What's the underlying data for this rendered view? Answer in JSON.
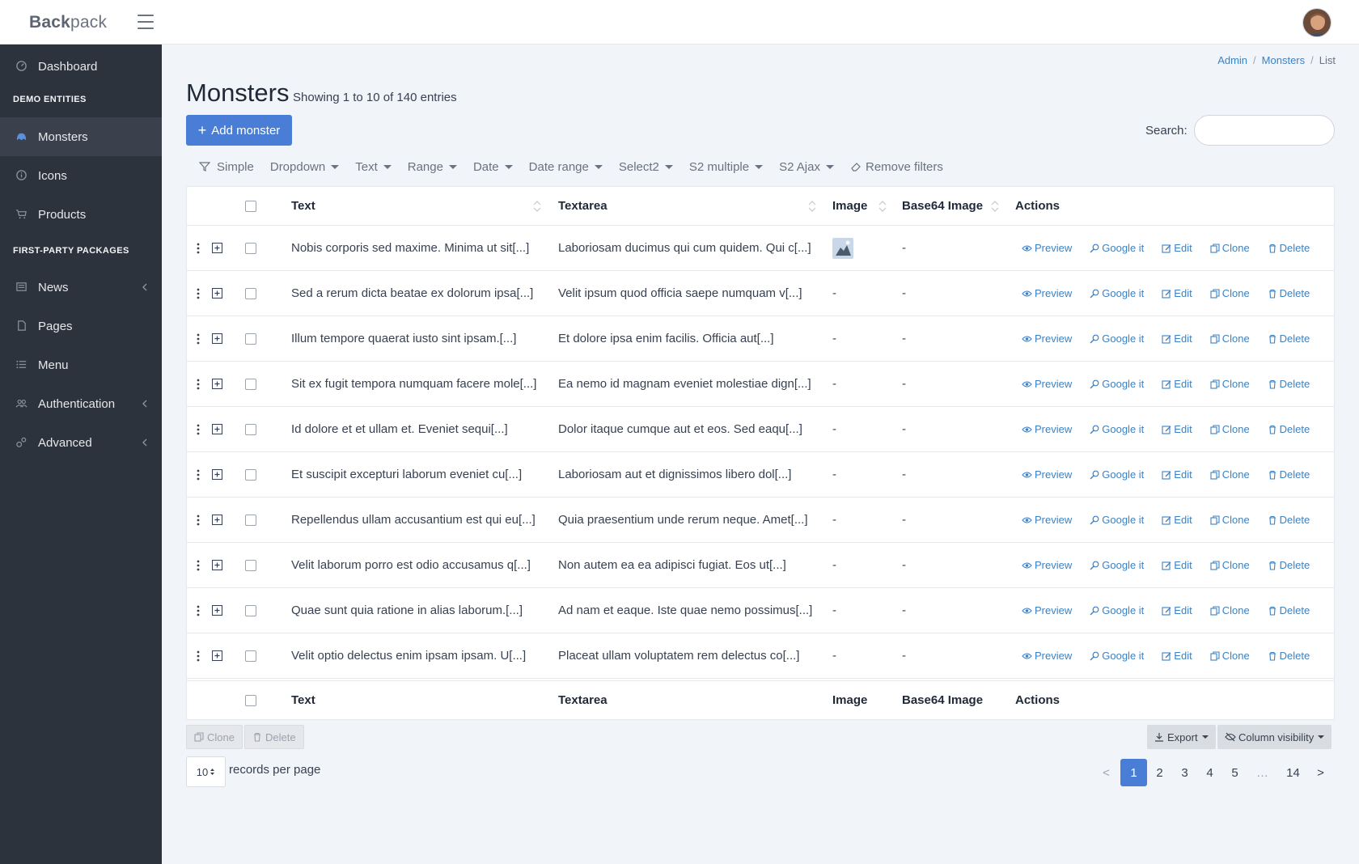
{
  "brand": {
    "bold": "Back",
    "rest": "pack"
  },
  "sidebar": {
    "dashboard": "Dashboard",
    "section_demo": "DEMO ENTITIES",
    "monsters": "Monsters",
    "icons": "Icons",
    "products": "Products",
    "section_packages": "FIRST-PARTY PACKAGES",
    "news": "News",
    "pages": "Pages",
    "menu": "Menu",
    "authentication": "Authentication",
    "advanced": "Advanced"
  },
  "breadcrumb": {
    "admin": "Admin",
    "monsters": "Monsters",
    "list": "List"
  },
  "page": {
    "title": "Monsters",
    "subtitle": "Showing 1 to 10 of 140 entries",
    "add_label": "Add monster",
    "search_label": "Search:",
    "search_value": ""
  },
  "filters": {
    "simple": "Simple",
    "dropdown": "Dropdown",
    "text": "Text",
    "range": "Range",
    "date": "Date",
    "date_range": "Date range",
    "select2": "Select2",
    "s2_multiple": "S2 multiple",
    "s2_ajax": "S2 Ajax",
    "remove": "Remove filters"
  },
  "table": {
    "columns": {
      "text": "Text",
      "textarea": "Textarea",
      "image": "Image",
      "base64": "Base64 Image",
      "actions": "Actions"
    },
    "actions": {
      "preview": "Preview",
      "google": "Google it",
      "edit": "Edit",
      "clone": "Clone",
      "delete": "Delete"
    },
    "rows": [
      {
        "text": "Nobis corporis sed maxime. Minima ut sit[...]",
        "textarea": "Laboriosam ducimus qui cum quidem. Qui c[...]",
        "image": "",
        "base64": "-"
      },
      {
        "text": "Sed a rerum dicta beatae ex dolorum ipsa[...]",
        "textarea": "Velit ipsum quod officia saepe numquam v[...]",
        "image": "-",
        "base64": "-"
      },
      {
        "text": "Illum tempore quaerat iusto sint ipsam.[...]",
        "textarea": "Et dolore ipsa enim facilis. Officia aut[...]",
        "image": "-",
        "base64": "-"
      },
      {
        "text": "Sit ex fugit tempora numquam facere mole[...]",
        "textarea": "Ea nemo id magnam eveniet molestiae dign[...]",
        "image": "-",
        "base64": "-"
      },
      {
        "text": "Id dolore et et ullam et. Eveniet sequi[...]",
        "textarea": "Dolor itaque cumque aut et eos. Sed eaqu[...]",
        "image": "-",
        "base64": "-"
      },
      {
        "text": "Et suscipit excepturi laborum eveniet cu[...]",
        "textarea": "Laboriosam aut et dignissimos libero dol[...]",
        "image": "-",
        "base64": "-"
      },
      {
        "text": "Repellendus ullam accusantium est qui eu[...]",
        "textarea": "Quia praesentium unde rerum neque. Amet[...]",
        "image": "-",
        "base64": "-"
      },
      {
        "text": "Velit laborum porro est odio accusamus q[...]",
        "textarea": "Non autem ea ea adipisci fugiat. Eos ut[...]",
        "image": "-",
        "base64": "-"
      },
      {
        "text": "Quae sunt quia ratione in alias laborum.[...]",
        "textarea": "Ad nam et eaque. Iste quae nemo possimus[...]",
        "image": "-",
        "base64": "-"
      },
      {
        "text": "Velit optio delectus enim ipsam ipsam. U[...]",
        "textarea": "Placeat ullam voluptatem rem delectus co[...]",
        "image": "-",
        "base64": "-"
      }
    ]
  },
  "bottom": {
    "clone": "Clone",
    "delete": "Delete",
    "export": "Export",
    "column_visibility": "Column visibility",
    "per_page": "10",
    "per_page_label": "records per page"
  },
  "pagination": {
    "prev": "<",
    "p1": "1",
    "p2": "2",
    "p3": "3",
    "p4": "4",
    "p5": "5",
    "ellipsis": "…",
    "p14": "14",
    "next": ">"
  },
  "colors": {
    "accent": "#4a7ed6",
    "sidebar": "#2d333d",
    "link": "#3b82c4"
  }
}
